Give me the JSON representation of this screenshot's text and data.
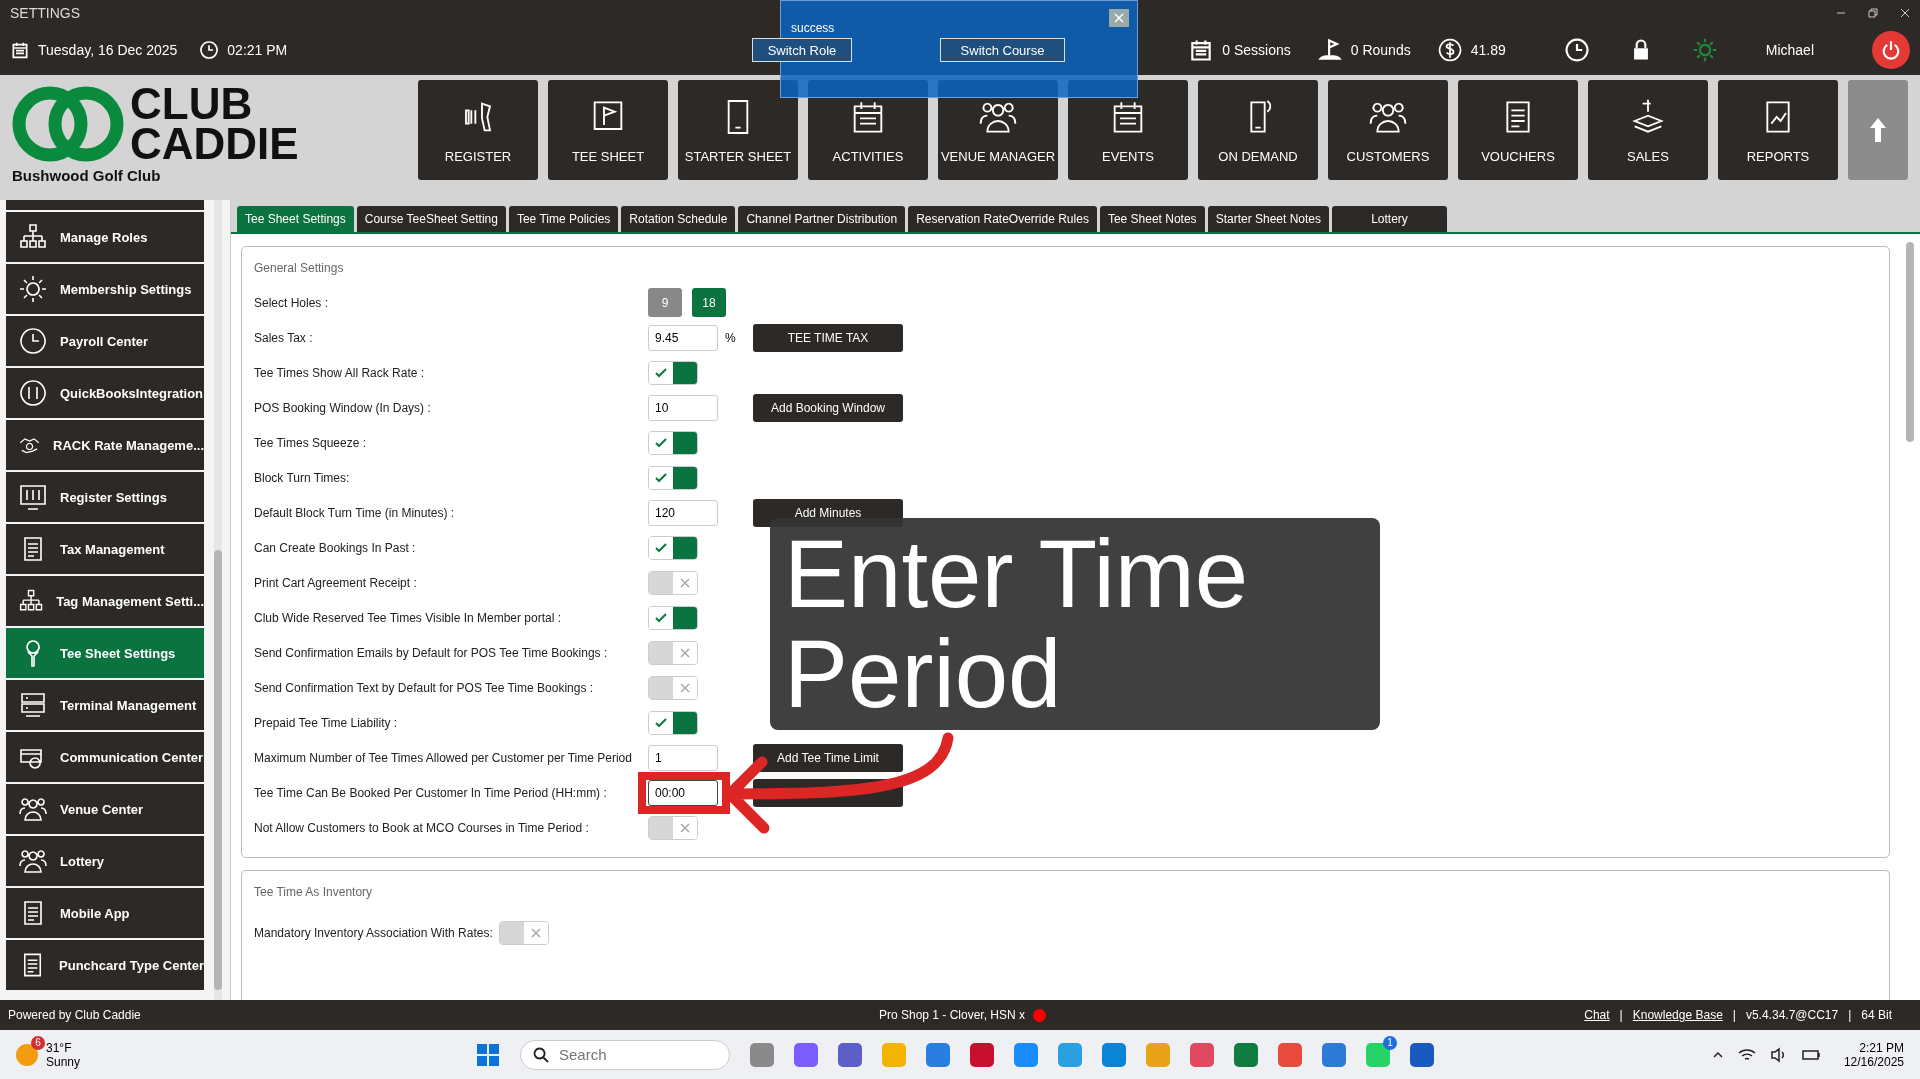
{
  "window": {
    "title": "SETTINGS"
  },
  "info_bar": {
    "date": "Tuesday,  16 Dec 2025",
    "time": "02:21 PM",
    "buttons": [
      "Switch Role",
      "Switch Course"
    ],
    "sessions": "0 Sessions",
    "rounds": "0 Rounds",
    "balance": "41.89",
    "user": "Michael"
  },
  "notification": {
    "message": "success"
  },
  "logo": {
    "line_1": "CLUB",
    "line_2": "CADDIE",
    "club": "Bushwood Golf Club"
  },
  "nav": [
    {
      "label": "REGISTER"
    },
    {
      "label": "TEE SHEET"
    },
    {
      "label": "STARTER SHEET"
    },
    {
      "label": "ACTIVITIES"
    },
    {
      "label": "VENUE MANAGER"
    },
    {
      "label": "EVENTS"
    },
    {
      "label": "ON DEMAND"
    },
    {
      "label": "CUSTOMERS"
    },
    {
      "label": "VOUCHERS"
    },
    {
      "label": "SALES"
    },
    {
      "label": "REPORTS"
    }
  ],
  "sidebar": {
    "items": [
      {
        "label": "Manage Roles",
        "selected": false
      },
      {
        "label": "Membership Settings",
        "selected": false
      },
      {
        "label": "Payroll Center",
        "selected": false
      },
      {
        "label": "QuickBooksIntegration",
        "selected": false
      },
      {
        "label": "RACK Rate Manageme...",
        "selected": false
      },
      {
        "label": "Register Settings",
        "selected": false
      },
      {
        "label": "Tax Management",
        "selected": false
      },
      {
        "label": "Tag Management Setti...",
        "selected": false
      },
      {
        "label": "Tee Sheet Settings",
        "selected": true
      },
      {
        "label": "Terminal Management",
        "selected": false
      },
      {
        "label": "Communication Center",
        "selected": false
      },
      {
        "label": "Venue Center",
        "selected": false
      },
      {
        "label": "Lottery",
        "selected": false
      },
      {
        "label": "Mobile App",
        "selected": false
      },
      {
        "label": "Punchcard Type Center",
        "selected": false
      }
    ]
  },
  "tabs": [
    {
      "label": "Tee Sheet Settings",
      "selected": true
    },
    {
      "label": "Course TeeSheet Setting",
      "selected": false
    },
    {
      "label": "Tee Time Policies",
      "selected": false
    },
    {
      "label": "Rotation Schedule",
      "selected": false
    },
    {
      "label": "Channel Partner Distribution",
      "selected": false
    },
    {
      "label": "Reservation RateOverride Rules",
      "selected": false
    },
    {
      "label": "Tee Sheet Notes",
      "selected": false
    },
    {
      "label": "Starter Sheet Notes",
      "selected": false
    },
    {
      "label": "Lottery",
      "selected": false
    }
  ],
  "sections": [
    {
      "title": "General Settings",
      "rows": [
        {
          "label": "Select Holes :",
          "kind": "holes",
          "options": [
            {
              "label": "9",
              "selected": false
            },
            {
              "label": "18",
              "selected": true
            }
          ]
        },
        {
          "label": "Sales Tax :",
          "kind": "input",
          "value": "9.45",
          "unit": "%",
          "button": "TEE TIME TAX"
        },
        {
          "label": "Tee Times Show All Rack Rate :",
          "kind": "toggle",
          "on": true
        },
        {
          "label": "POS Booking Window (In Days) :",
          "kind": "input",
          "value": "10",
          "button": "Add Booking Window"
        },
        {
          "label": "Tee Times Squeeze :",
          "kind": "toggle",
          "on": true
        },
        {
          "label": "Block Turn Times:",
          "kind": "toggle",
          "on": true
        },
        {
          "label": "Default Block Turn Time (in Minutes) :",
          "kind": "input",
          "value": "120",
          "button": "Add Minutes"
        },
        {
          "label": "Can Create Bookings In Past :",
          "kind": "toggle",
          "on": true
        },
        {
          "label": "Print Cart Agreement Receipt :",
          "kind": "toggle",
          "on": false
        },
        {
          "label": "Club Wide Reserved Tee Times Visible In Member portal :",
          "kind": "toggle",
          "on": true
        },
        {
          "label": "Send Confirmation Emails by Default for POS Tee Time Bookings :",
          "kind": "toggle",
          "on": false
        },
        {
          "label": "Send Confirmation Text by Default for POS Tee Time Bookings :",
          "kind": "toggle",
          "on": false
        },
        {
          "label": "Prepaid Tee Time Liability :",
          "kind": "toggle",
          "on": true
        },
        {
          "label": "Maximum Number of Tee Times Allowed per Customer per Time Period",
          "kind": "input",
          "value": "1",
          "button": "Add Tee Time Limit"
        },
        {
          "label": "Tee Time Can Be Booked Per Customer In Time Period (HH:mm) :",
          "kind": "input",
          "value": "00:00",
          "focused": true,
          "highlighted": true,
          "blank_button": true
        },
        {
          "label": "Not Allow Customers to Book at MCO Courses in Time Period :",
          "kind": "toggle",
          "on": false
        }
      ]
    },
    {
      "title": "Tee Time As Inventory",
      "rows": [
        {
          "label": "Mandatory Inventory Association With Rates:",
          "kind": "toggle",
          "on": false
        }
      ]
    }
  ],
  "callout": {
    "text": "Enter Time Period"
  },
  "status_bar": {
    "left": "Powered by Club Caddie",
    "center": "Pro Shop 1 - Clover, HSN x",
    "items": [
      {
        "kind": "link",
        "text": "Chat"
      },
      {
        "kind": "sep",
        "text": "|"
      },
      {
        "kind": "link",
        "text": "Knowledge Base"
      },
      {
        "kind": "sep",
        "text": "|"
      },
      {
        "kind": "text",
        "text": "v5.4.34.7@CC17"
      },
      {
        "kind": "sep",
        "text": "|"
      },
      {
        "kind": "text",
        "text": "64 Bit"
      }
    ]
  },
  "taskbar": {
    "weather": {
      "badge": "6",
      "temp": "31°F",
      "condition": "Sunny"
    },
    "search": {
      "placeholder": "Search"
    },
    "app_badge": "1",
    "time": "2:21 PM",
    "date": "12/16/2025"
  }
}
